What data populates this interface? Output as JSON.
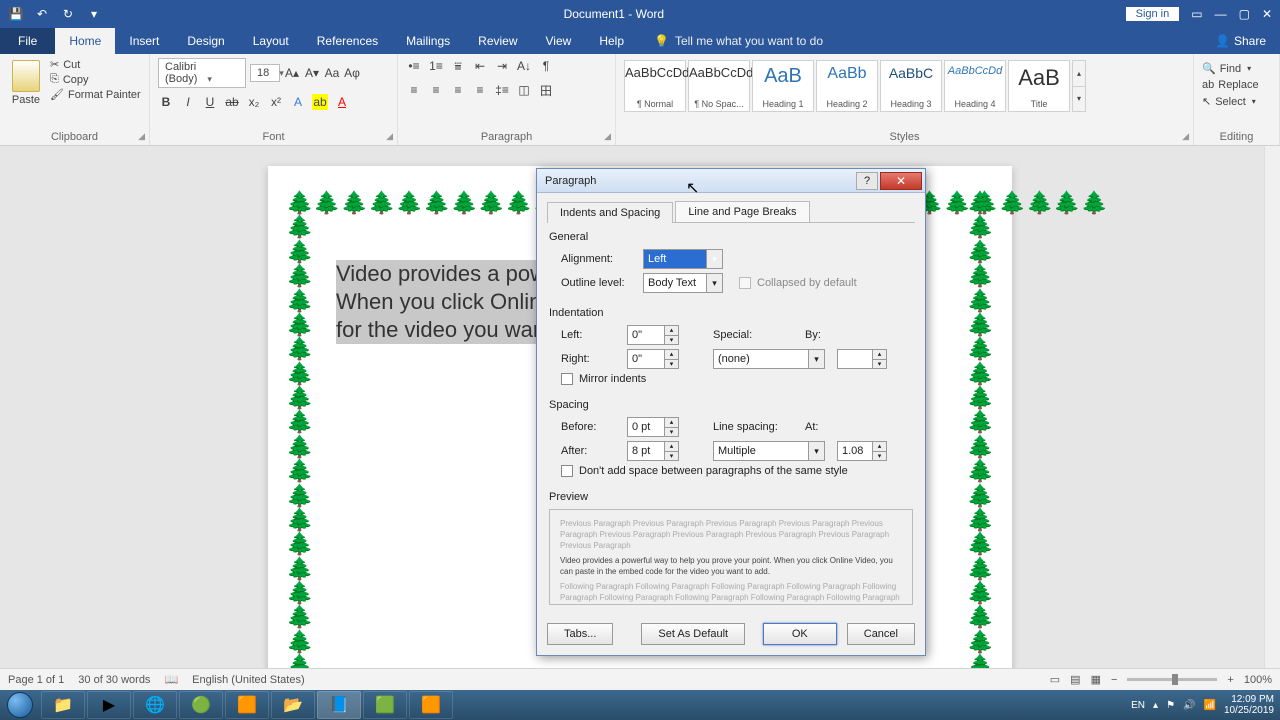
{
  "title": "Document1 - Word",
  "signin": "Sign in",
  "qat": {
    "save": "💾",
    "undo": "↶",
    "redo": "↻",
    "custom": "▾"
  },
  "tabs": {
    "file": "File",
    "home": "Home",
    "insert": "Insert",
    "design": "Design",
    "layout": "Layout",
    "references": "References",
    "mailings": "Mailings",
    "review": "Review",
    "view": "View",
    "help": "Help",
    "tell": "Tell me what you want to do",
    "share": "Share"
  },
  "clipboard": {
    "paste": "Paste",
    "cut": "Cut",
    "copy": "Copy",
    "format_painter": "Format Painter",
    "label": "Clipboard"
  },
  "font": {
    "name": "Calibri (Body)",
    "size": "18",
    "label": "Font"
  },
  "paragraph": {
    "label": "Paragraph"
  },
  "styles": {
    "label": "Styles",
    "items": [
      {
        "sample": "AaBbCcDd",
        "name": "¶ Normal"
      },
      {
        "sample": "AaBbCcDd",
        "name": "¶ No Spac..."
      },
      {
        "sample": "AaB",
        "name": "Heading 1"
      },
      {
        "sample": "AaBb",
        "name": "Heading 2"
      },
      {
        "sample": "AaBbC",
        "name": "Heading 3"
      },
      {
        "sample": "AaBbCcDd",
        "name": "Heading 4"
      },
      {
        "sample": "AaB",
        "name": "Title"
      }
    ]
  },
  "editing": {
    "find": "Find",
    "replace": "Replace",
    "select": "Select",
    "label": "Editing"
  },
  "doc": {
    "line1": "Video provides a pow",
    "line2": "When you click Onlin",
    "line3": "for the video you wan"
  },
  "dialog": {
    "title": "Paragraph",
    "tab1": "Indents and Spacing",
    "tab2": "Line and Page Breaks",
    "general": "General",
    "alignment_lbl": "Alignment:",
    "alignment_val": "Left",
    "outline_lbl": "Outline level:",
    "outline_val": "Body Text",
    "collapsed": "Collapsed by default",
    "indentation": "Indentation",
    "left_lbl": "Left:",
    "left_val": "0\"",
    "right_lbl": "Right:",
    "right_val": "0\"",
    "special_lbl": "Special:",
    "special_val": "(none)",
    "by_lbl": "By:",
    "by_val": "",
    "mirror": "Mirror indents",
    "spacing": "Spacing",
    "before_lbl": "Before:",
    "before_val": "0 pt",
    "after_lbl": "After:",
    "after_val": "8 pt",
    "line_lbl": "Line spacing:",
    "line_val": "Multiple",
    "at_lbl": "At:",
    "at_val": "1.08",
    "dontadd": "Don't add space between paragraphs of the same style",
    "preview": "Preview",
    "preview_prev": "Previous Paragraph Previous Paragraph Previous Paragraph Previous Paragraph Previous Paragraph Previous Paragraph Previous Paragraph Previous Paragraph Previous Paragraph Previous Paragraph",
    "preview_body": "Video provides a powerful way to help you prove your point. When you click Online Video, you can paste in the embed code for the video you want to add.",
    "preview_next": "Following Paragraph Following Paragraph Following Paragraph Following Paragraph Following Paragraph Following Paragraph Following Paragraph Following Paragraph Following Paragraph Following Paragraph",
    "tabs_btn": "Tabs...",
    "default_btn": "Set As Default",
    "ok": "OK",
    "cancel": "Cancel"
  },
  "status": {
    "page": "Page 1 of 1",
    "words": "30 of 30 words",
    "lang": "English (United States)",
    "zoom": "100%"
  },
  "tray": {
    "lang": "EN",
    "time": "12:09 PM",
    "date": "10/25/2019"
  }
}
